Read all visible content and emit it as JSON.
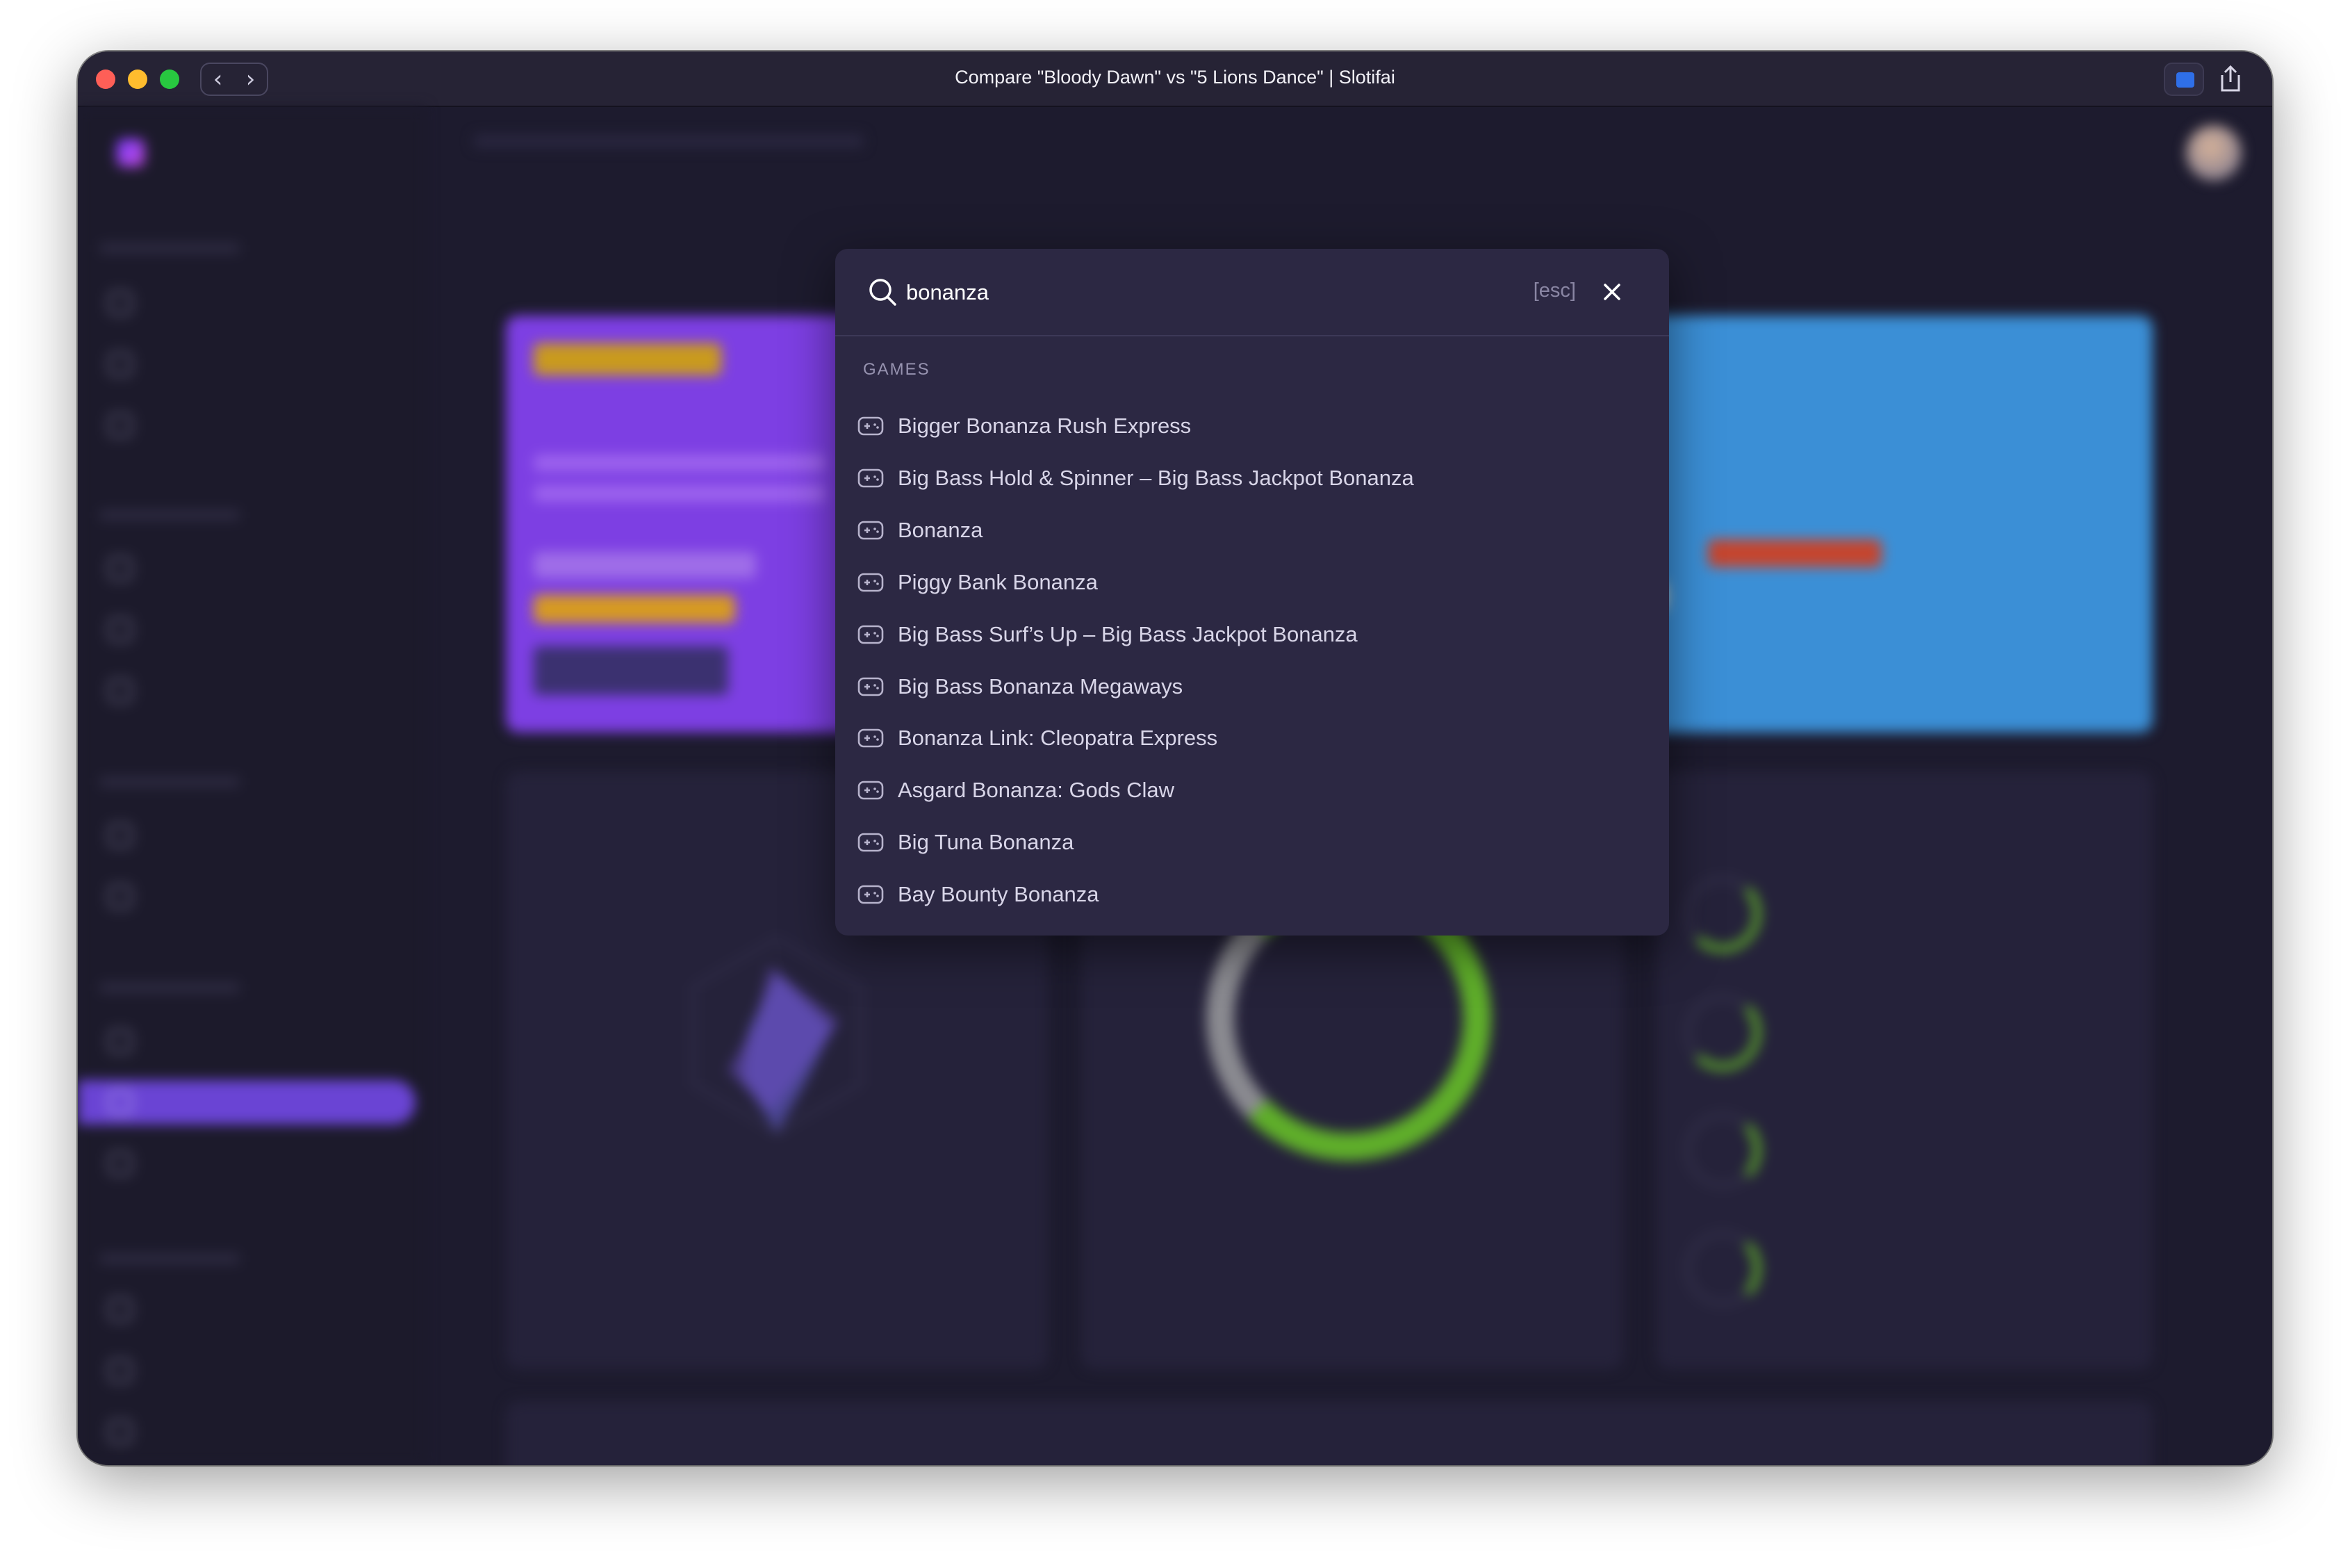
{
  "window": {
    "title": "Compare \"Bloody Dawn\" vs \"5 Lions Dance\" | Slotifai",
    "nav_back": "‹",
    "nav_forward": "›"
  },
  "search": {
    "query": "bonanza",
    "esc_hint": "[esc]",
    "section_label": "GAMES",
    "results": [
      {
        "label": "Bigger Bonanza Rush Express"
      },
      {
        "label": "Big Bass Hold & Spinner – Big Bass Jackpot Bonanza"
      },
      {
        "label": "Bonanza"
      },
      {
        "label": "Piggy Bank Bonanza"
      },
      {
        "label": "Big Bass Surf’s Up – Big Bass Jackpot Bonanza"
      },
      {
        "label": "Big Bass Bonanza Megaways"
      },
      {
        "label": "Bonanza Link: Cleopatra Express"
      },
      {
        "label": "Asgard Bonanza: Gods Claw"
      },
      {
        "label": "Big Tuna Bonanza"
      },
      {
        "label": "Bay Bounty Bonanza"
      }
    ]
  },
  "colors": {
    "accent": "#6a44d4",
    "hero_left": "#7d3fe3",
    "hero_right": "#3b8fd6",
    "ring_green": "#5fae2a"
  }
}
